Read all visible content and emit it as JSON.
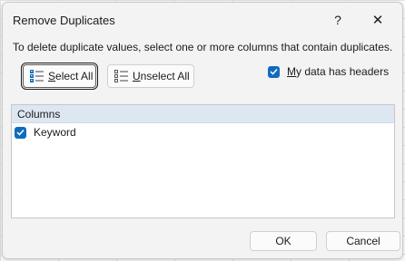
{
  "dialog": {
    "title": "Remove Duplicates",
    "help_label": "?",
    "close_label": "✕",
    "instruction": "To delete duplicate values, select one or more columns that contain duplicates.",
    "select_all": {
      "underlined": "S",
      "rest": "elect All"
    },
    "unselect_all": {
      "underlined": "U",
      "rest": "nselect All"
    },
    "headers_checkbox": {
      "underlined": "M",
      "rest": "y data has headers",
      "checked": true
    },
    "columns_header": "Columns",
    "columns": [
      {
        "label": "Keyword",
        "checked": true
      }
    ],
    "ok_label": "OK",
    "cancel_label": "Cancel"
  },
  "colors": {
    "accent": "#0f6cbd",
    "list_header_bg": "#dde7f2",
    "dialog_bg": "#f3f3f3"
  }
}
